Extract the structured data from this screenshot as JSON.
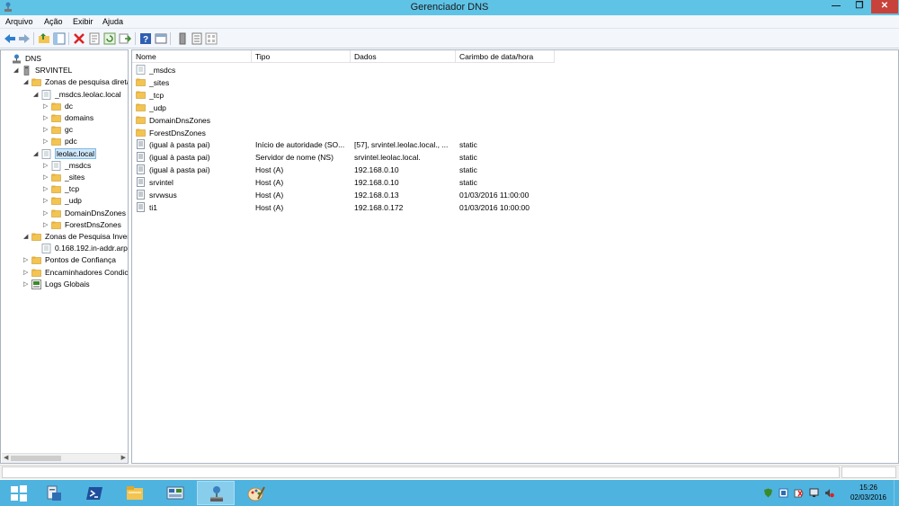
{
  "window": {
    "title": "Gerenciador DNS",
    "min_glyph": "—",
    "max_glyph": "❐",
    "close_glyph": "✕"
  },
  "menu": [
    "Arquivo",
    "Ação",
    "Exibir",
    "Ajuda"
  ],
  "toolbar": {
    "icons": [
      "back-icon",
      "forward-icon",
      "up-folder-icon",
      "show-hide-tree-icon",
      "delete-icon",
      "properties-icon",
      "refresh-icon",
      "export-list-icon",
      "help-icon",
      "console-icon",
      "server-icon",
      "list-view-icon",
      "detail-view-icon"
    ]
  },
  "tree": {
    "nodes": [
      {
        "label": "DNS",
        "level": 0,
        "expander": "",
        "icon": "dns-icon"
      },
      {
        "label": "SRVINTEL",
        "level": 1,
        "expander": "◢",
        "icon": "server-icon"
      },
      {
        "label": "Zonas de pesquisa direta",
        "level": 2,
        "expander": "◢",
        "icon": "folder-icon"
      },
      {
        "label": "_msdcs.leolac.local",
        "level": 3,
        "expander": "◢",
        "icon": "zone-icon"
      },
      {
        "label": "dc",
        "level": 4,
        "expander": "▷",
        "icon": "folder-icon"
      },
      {
        "label": "domains",
        "level": 4,
        "expander": "▷",
        "icon": "folder-icon"
      },
      {
        "label": "gc",
        "level": 4,
        "expander": "▷",
        "icon": "folder-icon"
      },
      {
        "label": "pdc",
        "level": 4,
        "expander": "▷",
        "icon": "folder-icon"
      },
      {
        "label": "leolac.local",
        "level": 3,
        "expander": "◢",
        "icon": "zone-icon",
        "selected": true
      },
      {
        "label": "_msdcs",
        "level": 4,
        "expander": "▷",
        "icon": "zone-icon"
      },
      {
        "label": "_sites",
        "level": 4,
        "expander": "▷",
        "icon": "folder-icon"
      },
      {
        "label": "_tcp",
        "level": 4,
        "expander": "▷",
        "icon": "folder-icon"
      },
      {
        "label": "_udp",
        "level": 4,
        "expander": "▷",
        "icon": "folder-icon"
      },
      {
        "label": "DomainDnsZones",
        "level": 4,
        "expander": "▷",
        "icon": "folder-icon"
      },
      {
        "label": "ForestDnsZones",
        "level": 4,
        "expander": "▷",
        "icon": "folder-icon"
      },
      {
        "label": "Zonas de Pesquisa Invers",
        "level": 2,
        "expander": "◢",
        "icon": "folder-icon"
      },
      {
        "label": "0.168.192.in-addr.arp",
        "level": 3,
        "expander": "",
        "icon": "zone-icon"
      },
      {
        "label": "Pontos de Confiança",
        "level": 2,
        "expander": "▷",
        "icon": "folder-icon"
      },
      {
        "label": "Encaminhadores Condic",
        "level": 2,
        "expander": "▷",
        "icon": "folder-icon"
      },
      {
        "label": "Logs Globais",
        "level": 2,
        "expander": "▷",
        "icon": "log-icon"
      }
    ]
  },
  "list": {
    "columns": [
      "Nome",
      "Tipo",
      "Dados",
      "Carimbo de data/hora"
    ],
    "rows": [
      {
        "icon": "zone-icon",
        "name": "_msdcs",
        "type": "",
        "data": "",
        "timestamp": ""
      },
      {
        "icon": "folder-icon",
        "name": "_sites",
        "type": "",
        "data": "",
        "timestamp": ""
      },
      {
        "icon": "folder-icon",
        "name": "_tcp",
        "type": "",
        "data": "",
        "timestamp": ""
      },
      {
        "icon": "folder-icon",
        "name": "_udp",
        "type": "",
        "data": "",
        "timestamp": ""
      },
      {
        "icon": "folder-icon",
        "name": "DomainDnsZones",
        "type": "",
        "data": "",
        "timestamp": ""
      },
      {
        "icon": "folder-icon",
        "name": "ForestDnsZones",
        "type": "",
        "data": "",
        "timestamp": ""
      },
      {
        "icon": "record-icon",
        "name": "(igual à pasta pai)",
        "type": "Início de autoridade (SO...",
        "data": "[57], srvintel.leolac.local., ...",
        "timestamp": "static"
      },
      {
        "icon": "record-icon",
        "name": "(igual à pasta pai)",
        "type": "Servidor de nome (NS)",
        "data": "srvintel.leolac.local.",
        "timestamp": "static"
      },
      {
        "icon": "record-icon",
        "name": "(igual à pasta pai)",
        "type": "Host (A)",
        "data": "192.168.0.10",
        "timestamp": "static"
      },
      {
        "icon": "record-icon",
        "name": "srvintel",
        "type": "Host (A)",
        "data": "192.168.0.10",
        "timestamp": "static"
      },
      {
        "icon": "record-icon",
        "name": "srvwsus",
        "type": "Host (A)",
        "data": "192.168.0.13",
        "timestamp": "01/03/2016 11:00:00"
      },
      {
        "icon": "record-icon",
        "name": "ti1",
        "type": "Host (A)",
        "data": "192.168.0.172",
        "timestamp": "01/03/2016 10:00:00"
      }
    ]
  },
  "taskbar": {
    "apps": [
      "start-icon",
      "server-manager-icon",
      "powershell-icon",
      "file-explorer-icon",
      "control-panel-icon",
      "dns-manager-icon",
      "paint-icon"
    ],
    "active": "dns-manager-icon",
    "tray_icons": [
      "security-icon",
      "network-share-icon",
      "action-center-icon",
      "display-icon",
      "volume-muted-icon"
    ],
    "time": "15:26",
    "date": "02/03/2016"
  },
  "colors": {
    "titlebar": "#5fc3e6",
    "taskbar": "#4fb3df",
    "selection": "#cfe7fa",
    "folder": "#f3c451"
  }
}
